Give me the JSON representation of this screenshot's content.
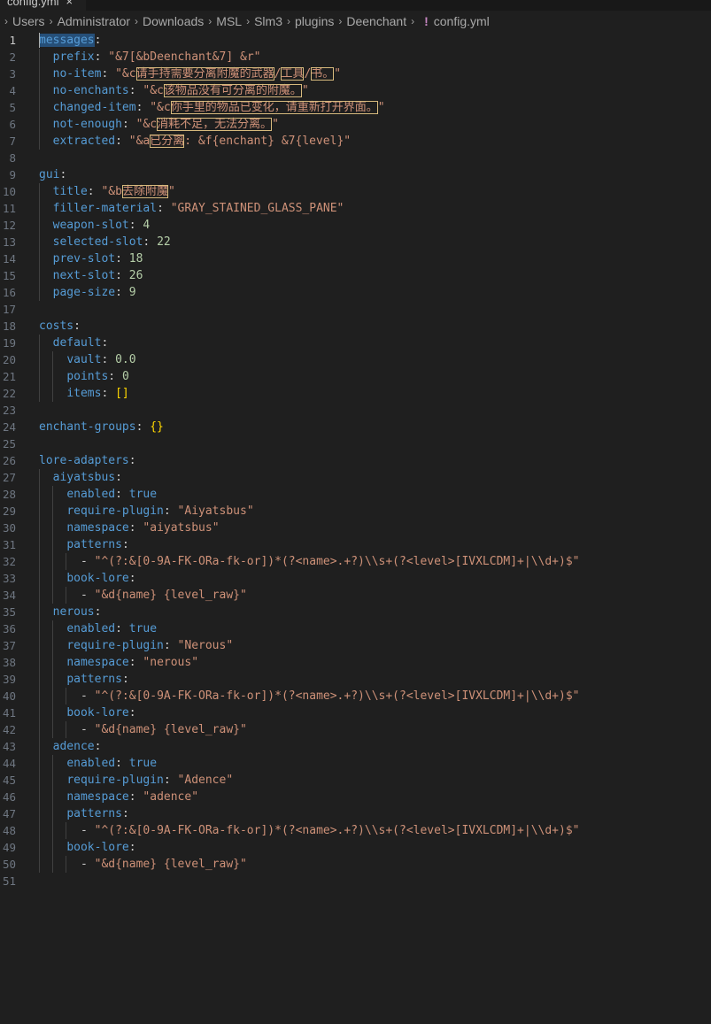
{
  "tab": {
    "label": "config.yml",
    "close": "×"
  },
  "breadcrumb": [
    "",
    "Users",
    "Administrator",
    "Downloads",
    "MSL",
    "Slm3",
    "plugins",
    "Deenchant",
    "config.yml"
  ],
  "lines": [
    [
      [
        "k",
        "messages"
      ],
      [
        "p",
        ":"
      ]
    ],
    [
      [
        "p",
        "  "
      ],
      [
        "k",
        "prefix"
      ],
      [
        "p",
        ": "
      ],
      [
        "s",
        "\"&7[&bDeenchant&7] &r\""
      ]
    ],
    [
      [
        "p",
        "  "
      ],
      [
        "k",
        "no-item"
      ],
      [
        "p",
        ": "
      ],
      [
        "s",
        "\"&c"
      ],
      [
        "sh",
        "请手持需要分离附魔的武器"
      ],
      [
        "s",
        "/"
      ],
      [
        "sh",
        "工具"
      ],
      [
        "s",
        "/"
      ],
      [
        "sh",
        "书。"
      ],
      [
        "s",
        "\""
      ]
    ],
    [
      [
        "p",
        "  "
      ],
      [
        "k",
        "no-enchants"
      ],
      [
        "p",
        ": "
      ],
      [
        "s",
        "\"&c"
      ],
      [
        "sh",
        "该物品没有可分离的附魔。"
      ],
      [
        "s",
        "\""
      ]
    ],
    [
      [
        "p",
        "  "
      ],
      [
        "k",
        "changed-item"
      ],
      [
        "p",
        ": "
      ],
      [
        "s",
        "\"&c"
      ],
      [
        "sh",
        "你手里的物品已变化，请重新打开界面。"
      ],
      [
        "s",
        "\""
      ]
    ],
    [
      [
        "p",
        "  "
      ],
      [
        "k",
        "not-enough"
      ],
      [
        "p",
        ": "
      ],
      [
        "s",
        "\"&c"
      ],
      [
        "sh",
        "消耗不足，无法分离。"
      ],
      [
        "s",
        "\""
      ]
    ],
    [
      [
        "p",
        "  "
      ],
      [
        "k",
        "extracted"
      ],
      [
        "p",
        ": "
      ],
      [
        "s",
        "\"&a"
      ],
      [
        "sh",
        "已分离"
      ],
      [
        "s",
        ": &f{enchant} &7{level}\""
      ]
    ],
    [],
    [
      [
        "k",
        "gui"
      ],
      [
        "p",
        ":"
      ]
    ],
    [
      [
        "p",
        "  "
      ],
      [
        "k",
        "title"
      ],
      [
        "p",
        ": "
      ],
      [
        "s",
        "\"&b"
      ],
      [
        "sh",
        "去除附魔"
      ],
      [
        "s",
        "\""
      ]
    ],
    [
      [
        "p",
        "  "
      ],
      [
        "k",
        "filler-material"
      ],
      [
        "p",
        ": "
      ],
      [
        "s",
        "\"GRAY_STAINED_GLASS_PANE\""
      ]
    ],
    [
      [
        "p",
        "  "
      ],
      [
        "k",
        "weapon-slot"
      ],
      [
        "p",
        ": "
      ],
      [
        "n",
        "4"
      ]
    ],
    [
      [
        "p",
        "  "
      ],
      [
        "k",
        "selected-slot"
      ],
      [
        "p",
        ": "
      ],
      [
        "n",
        "22"
      ]
    ],
    [
      [
        "p",
        "  "
      ],
      [
        "k",
        "prev-slot"
      ],
      [
        "p",
        ": "
      ],
      [
        "n",
        "18"
      ]
    ],
    [
      [
        "p",
        "  "
      ],
      [
        "k",
        "next-slot"
      ],
      [
        "p",
        ": "
      ],
      [
        "n",
        "26"
      ]
    ],
    [
      [
        "p",
        "  "
      ],
      [
        "k",
        "page-size"
      ],
      [
        "p",
        ": "
      ],
      [
        "n",
        "9"
      ]
    ],
    [],
    [
      [
        "k",
        "costs"
      ],
      [
        "p",
        ":"
      ]
    ],
    [
      [
        "p",
        "  "
      ],
      [
        "k",
        "default"
      ],
      [
        "p",
        ":"
      ]
    ],
    [
      [
        "p",
        "    "
      ],
      [
        "k",
        "vault"
      ],
      [
        "p",
        ": "
      ],
      [
        "n",
        "0.0"
      ]
    ],
    [
      [
        "p",
        "    "
      ],
      [
        "k",
        "points"
      ],
      [
        "p",
        ": "
      ],
      [
        "n",
        "0"
      ]
    ],
    [
      [
        "p",
        "    "
      ],
      [
        "k",
        "items"
      ],
      [
        "p",
        ": "
      ],
      [
        "b",
        "[]"
      ]
    ],
    [],
    [
      [
        "k",
        "enchant-groups"
      ],
      [
        "p",
        ": "
      ],
      [
        "b",
        "{}"
      ]
    ],
    [],
    [
      [
        "k",
        "lore-adapters"
      ],
      [
        "p",
        ":"
      ]
    ],
    [
      [
        "p",
        "  "
      ],
      [
        "k",
        "aiyatsbus"
      ],
      [
        "p",
        ":"
      ]
    ],
    [
      [
        "p",
        "    "
      ],
      [
        "k",
        "enabled"
      ],
      [
        "p",
        ": "
      ],
      [
        "k",
        "true"
      ]
    ],
    [
      [
        "p",
        "    "
      ],
      [
        "k",
        "require-plugin"
      ],
      [
        "p",
        ": "
      ],
      [
        "s",
        "\"Aiyatsbus\""
      ]
    ],
    [
      [
        "p",
        "    "
      ],
      [
        "k",
        "namespace"
      ],
      [
        "p",
        ": "
      ],
      [
        "s",
        "\"aiyatsbus\""
      ]
    ],
    [
      [
        "p",
        "    "
      ],
      [
        "k",
        "patterns"
      ],
      [
        "p",
        ":"
      ]
    ],
    [
      [
        "p",
        "      "
      ],
      [
        "dash",
        "- "
      ],
      [
        "s",
        "\"^(?:&[0-9A-FK-ORa-fk-or])*(?<name>.+?)\\\\s+(?<level>[IVXLCDM]+|\\\\d+)$\""
      ]
    ],
    [
      [
        "p",
        "    "
      ],
      [
        "k",
        "book-lore"
      ],
      [
        "p",
        ":"
      ]
    ],
    [
      [
        "p",
        "      "
      ],
      [
        "dash",
        "- "
      ],
      [
        "s",
        "\"&d{name} {level_raw}\""
      ]
    ],
    [
      [
        "p",
        "  "
      ],
      [
        "k",
        "nerous"
      ],
      [
        "p",
        ":"
      ]
    ],
    [
      [
        "p",
        "    "
      ],
      [
        "k",
        "enabled"
      ],
      [
        "p",
        ": "
      ],
      [
        "k",
        "true"
      ]
    ],
    [
      [
        "p",
        "    "
      ],
      [
        "k",
        "require-plugin"
      ],
      [
        "p",
        ": "
      ],
      [
        "s",
        "\"Nerous\""
      ]
    ],
    [
      [
        "p",
        "    "
      ],
      [
        "k",
        "namespace"
      ],
      [
        "p",
        ": "
      ],
      [
        "s",
        "\"nerous\""
      ]
    ],
    [
      [
        "p",
        "    "
      ],
      [
        "k",
        "patterns"
      ],
      [
        "p",
        ":"
      ]
    ],
    [
      [
        "p",
        "      "
      ],
      [
        "dash",
        "- "
      ],
      [
        "s",
        "\"^(?:&[0-9A-FK-ORa-fk-or])*(?<name>.+?)\\\\s+(?<level>[IVXLCDM]+|\\\\d+)$\""
      ]
    ],
    [
      [
        "p",
        "    "
      ],
      [
        "k",
        "book-lore"
      ],
      [
        "p",
        ":"
      ]
    ],
    [
      [
        "p",
        "      "
      ],
      [
        "dash",
        "- "
      ],
      [
        "s",
        "\"&d{name} {level_raw}\""
      ]
    ],
    [
      [
        "p",
        "  "
      ],
      [
        "k",
        "adence"
      ],
      [
        "p",
        ":"
      ]
    ],
    [
      [
        "p",
        "    "
      ],
      [
        "k",
        "enabled"
      ],
      [
        "p",
        ": "
      ],
      [
        "k",
        "true"
      ]
    ],
    [
      [
        "p",
        "    "
      ],
      [
        "k",
        "require-plugin"
      ],
      [
        "p",
        ": "
      ],
      [
        "s",
        "\"Adence\""
      ]
    ],
    [
      [
        "p",
        "    "
      ],
      [
        "k",
        "namespace"
      ],
      [
        "p",
        ": "
      ],
      [
        "s",
        "\"adence\""
      ]
    ],
    [
      [
        "p",
        "    "
      ],
      [
        "k",
        "patterns"
      ],
      [
        "p",
        ":"
      ]
    ],
    [
      [
        "p",
        "      "
      ],
      [
        "dash",
        "- "
      ],
      [
        "s",
        "\"^(?:&[0-9A-FK-ORa-fk-or])*(?<name>.+?)\\\\s+(?<level>[IVXLCDM]+|\\\\d+)$\""
      ]
    ],
    [
      [
        "p",
        "    "
      ],
      [
        "k",
        "book-lore"
      ],
      [
        "p",
        ":"
      ]
    ],
    [
      [
        "p",
        "      "
      ],
      [
        "dash",
        "- "
      ],
      [
        "s",
        "\"&d{name} {level_raw}\""
      ]
    ],
    []
  ],
  "colors": {
    "key": "#569cd6",
    "string": "#ce9178",
    "number": "#b5cea8",
    "bracket": "#ffd700",
    "highlight": "#d7ba7d"
  },
  "icons": {
    "file": "yaml-exclamation-icon",
    "separator": "chevron-right-icon"
  }
}
